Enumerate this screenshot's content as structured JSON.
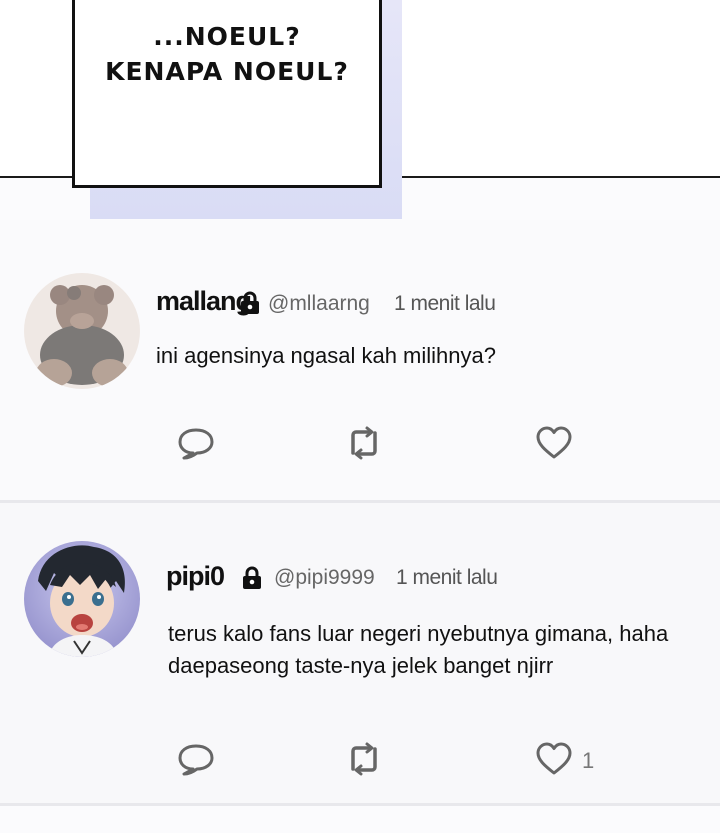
{
  "comic": {
    "speech_line1": "...NOEUL?",
    "speech_line2": "KENAPA NOEUL?"
  },
  "posts": [
    {
      "name": "mallang",
      "handle": "@mllaarng",
      "time": "1 menit lalu",
      "text": "ini agensinya ngasal kah milihnya?",
      "likes": ""
    },
    {
      "name": "pipi0",
      "handle": "@pipi9999",
      "time": "1 menit lalu",
      "text_line1": "terus kalo fans luar negeri nyebutnya gimana, haha",
      "text_line2": "daepaseong taste-nya jelek banget njirr",
      "likes": "1"
    }
  ],
  "icons": {
    "reply": "speech-bubble-icon",
    "retweet": "repost-icon",
    "like": "heart-icon",
    "lock": "lock-icon"
  }
}
